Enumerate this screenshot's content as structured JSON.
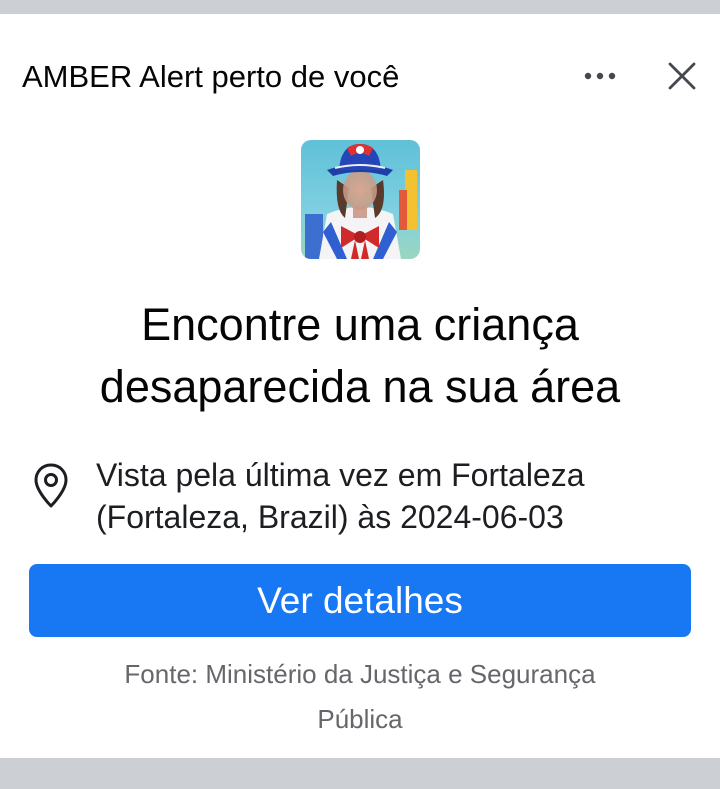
{
  "header": {
    "title": "AMBER Alert perto de você",
    "more_icon": "more-horizontal-icon",
    "close_icon": "close-icon"
  },
  "photo": {
    "description_icon": "child-photo"
  },
  "headline": {
    "line1": "Encontre uma criança",
    "line2": "desaparecida na sua área"
  },
  "location": {
    "icon": "location-pin-icon",
    "line1": "Vista pela última vez em Fortaleza",
    "line2": "(Fortaleza, Brazil) às 2024-06-03"
  },
  "cta": {
    "label": "Ver detalhes"
  },
  "source": {
    "line1": "Fonte: Ministério da Justiça e Segurança",
    "line2": "Pública"
  },
  "colors": {
    "primary_button": "#1877f2",
    "background": "#ccd0d5",
    "card": "#ffffff",
    "secondary_text": "#65676b"
  }
}
